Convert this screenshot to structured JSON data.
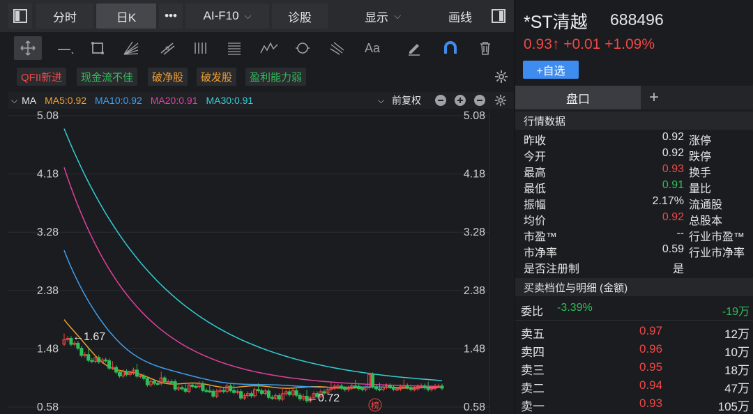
{
  "tabs": [
    {
      "label": "分时",
      "active": false
    },
    {
      "label": "日K",
      "active": true
    },
    {
      "label": "•••",
      "active": false
    },
    {
      "label": "AI-F10",
      "active": false
    },
    {
      "label": "诊股",
      "active": false
    }
  ],
  "display_menu": "显示",
  "draw_label": "画线",
  "tags": [
    {
      "label": "QFII新进",
      "color": "#f04848"
    },
    {
      "label": "现金流不佳",
      "color": "#2fbf5a"
    },
    {
      "label": "破净股",
      "color": "#f0a030"
    },
    {
      "label": "破发股",
      "color": "#f0a030"
    },
    {
      "label": "盈利能力弱",
      "color": "#2fbf5a"
    }
  ],
  "ma_bar": {
    "name": "MA",
    "ma5": "MA5:0.92",
    "ma10": "MA10:0.92",
    "ma20": "MA20:0.91",
    "ma30": "MA30:0.91",
    "adjust": "前复权",
    "colors": {
      "ma5": "#f0a030",
      "ma10": "#3ea0f0",
      "ma20": "#e040a0",
      "ma30": "#30d0d8"
    }
  },
  "chart_data": {
    "type": "candlestick",
    "y_ticks": [
      "5.08",
      "4.18",
      "3.28",
      "2.38",
      "1.48",
      "0.58"
    ],
    "ylim": [
      0.58,
      5.08
    ],
    "annotations": [
      {
        "label": "←1.67",
        "value": 1.67
      },
      {
        "label": "←0.72",
        "value": 0.72
      }
    ],
    "marker": "榜",
    "series": [
      {
        "name": "MA5",
        "color": "#f0a030"
      },
      {
        "name": "MA10",
        "color": "#3ea0f0"
      },
      {
        "name": "MA20",
        "color": "#e040a0"
      },
      {
        "name": "MA30",
        "color": "#30d0d8"
      }
    ]
  },
  "stock": {
    "name": "*ST清越",
    "code": "688496",
    "price": "0.93↑",
    "change": "+0.01",
    "change_pct": "+1.09%",
    "add_label": "+自选"
  },
  "panel_tab": "盘口",
  "panel_plus": "+",
  "quote_header": "行情数据",
  "quote_rows": [
    {
      "label": "昨收",
      "value": "0.92",
      "color": "",
      "label2": "涨停"
    },
    {
      "label": "今开",
      "value": "0.92",
      "color": "",
      "label2": "跌停"
    },
    {
      "label": "最高",
      "value": "0.93",
      "color": "red",
      "label2": "换手"
    },
    {
      "label": "最低",
      "value": "0.91",
      "color": "green",
      "label2": "量比"
    },
    {
      "label": "振幅",
      "value": "2.17%",
      "color": "",
      "label2": "流通股"
    },
    {
      "label": "均价",
      "value": "0.92",
      "color": "red",
      "label2": "总股本"
    },
    {
      "label": "市盈™",
      "value": "--",
      "color": "",
      "label2": "行业市盈™"
    },
    {
      "label": "市净率",
      "value": "0.59",
      "color": "",
      "label2": "行业市净率"
    },
    {
      "label": "是否注册制",
      "value": "是",
      "color": "",
      "label2": ""
    }
  ],
  "orderbook_header": "买卖档位与明细 (金额)",
  "weibi": {
    "label": "委比",
    "pct": "-3.39%",
    "amount": "-19万"
  },
  "sells": [
    {
      "label": "卖五",
      "price": "0.97",
      "vol": "12万"
    },
    {
      "label": "卖四",
      "price": "0.96",
      "vol": "10万"
    },
    {
      "label": "卖三",
      "price": "0.95",
      "vol": "18万"
    },
    {
      "label": "卖二",
      "price": "0.94",
      "vol": "47万"
    },
    {
      "label": "卖一",
      "price": "0.93",
      "vol": "105万"
    }
  ]
}
